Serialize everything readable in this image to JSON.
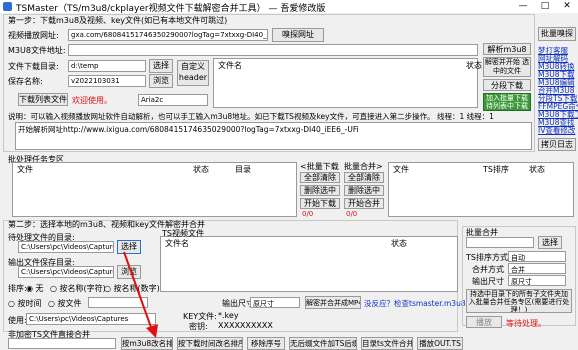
{
  "window": {
    "title": "TSMaster（TS/m3u8/ckplayer视频文件下载解密合并工具） — 吾爱修改版",
    "min": "—",
    "max": "□",
    "close": "✕"
  },
  "step1": {
    "title": "第一步：下载m3u8及视频、key文件(如已有本地文件可跳过)",
    "url_label": "视频播放网址:",
    "url_value": "gxa.com/6808415174635029000?logTag=7xtxxg-DI40_iEE6_-UFi",
    "browser_btn": "嗅探网址",
    "batch_btn": "批量嗅探",
    "m3u8_label": "M3U8文件地址:",
    "m3u8_value": "",
    "dir_label": "文件下载目录:",
    "dir_value": "d:\\temp",
    "select_btn": "选择",
    "name_label": "保存名称:",
    "name_value": "v2022103031",
    "browse_btn": "浏览",
    "custom_header_btn": "自定义 header",
    "file_col": "文件名",
    "status_col": "状态",
    "parse_btn": "解析m3u8",
    "start_btn": "解密并开始 选中的文件",
    "download_btn": "分段下载",
    "join_btn": "加入批量下载 待列表中下载 合并任务中",
    "download_list_btn": "下载列表文件",
    "welcome": "欢迎使用。",
    "engine_value": "Aria2c",
    "notice": "说明：可以输入视频播放网址软件自动解析，也可以手工输入m3u8地址。如已下载TS视频及key文件，可直接进入第二步操作。 线程：1   线程：1",
    "log_text": "开始解析网址http://www.ixigua.com/6808415174635029000?logTag=7xtxxg-DI40_iEE6_-UFi",
    "copy_btn": "拷贝日志"
  },
  "side_links": [
    "梦打客服",
    "网址解码",
    "M3U8转换",
    "M3U8下载",
    "M3U8编辑",
    "合并M3U8",
    "分段TS下载",
    "FFMPEG命令",
    "M3U8下载工具",
    "M3U8查找",
    "IV查看修改"
  ],
  "batch": {
    "title": "批处理任务专区",
    "file_col": "文件",
    "status_col": "状态",
    "dir_col": "目录",
    "dl_title": "<批量下载",
    "merge_title": "批量合并>",
    "dl_buttons": [
      "全部清除",
      "删除选中",
      "开始下载"
    ],
    "merge_buttons": [
      "全部清除",
      "删除选中",
      "开始合并"
    ],
    "dl_count": "0/0",
    "merge_count": "0/0",
    "right_file_col": "文件",
    "right_ts_col": "TS排序",
    "right_status_col": "状态"
  },
  "step2": {
    "title": "第二步：选择本地的m3u8、视频和key文件解密并合并",
    "src_label": "待处理文件的目录:",
    "src_value": "C:\\Users\\pc\\Videos\\Captures",
    "choose_btn": "选择",
    "out_label": "输出文件保存目录:",
    "out_value": "C:\\Users\\pc\\Videos\\Captures",
    "browse_btn": "浏览",
    "sort_label": "排序:",
    "sort_none": "无",
    "sort_num": "按名称(字符)",
    "sort_name": "按名称(数字)",
    "by_time": "按时间",
    "by_file": "按文件",
    "output_size_label": "输出尺寸",
    "output_size_value": "原尺寸",
    "merge_btn": "解密并合并成MP4",
    "check_ffmpeg": "没反应？检查tsmaster.m3u8",
    "use_label": "使用:",
    "use_value": "C:\\Users\\pc\\Videos\\Captures",
    "ts_list_title": "TS视频文件",
    "ts_file_col": "文件名",
    "ts_status_col": "状态",
    "key_label": "KEY文件:",
    "key_value": "*.key",
    "secret_label": "密钥:",
    "secret_value": "XXXXXXXXXX",
    "non_enc_label": "非加密TS文件直接合并",
    "bottom_buttons": [
      "按m3u8改名排序",
      "按下载时间改名排序",
      "移除序号",
      "无后缀文件加TS后缀",
      "目录ts文件合并",
      "播放OUT.TS"
    ]
  },
  "batch_merge": {
    "title": "批量合并",
    "choose_btn": "选择",
    "ts_sort_label": "TS排序方式",
    "ts_sort_value": "自动",
    "merge_mode_label": "合并方式",
    "merge_mode_value": "合并",
    "out_size_label": "输出尺寸",
    "out_size_value": "原尺寸",
    "hint": "持选中目录下的所有子文件夹加入批量合并任务专区(需要进行处理！)",
    "play_btn": "播放",
    "status": "等待处理。"
  }
}
